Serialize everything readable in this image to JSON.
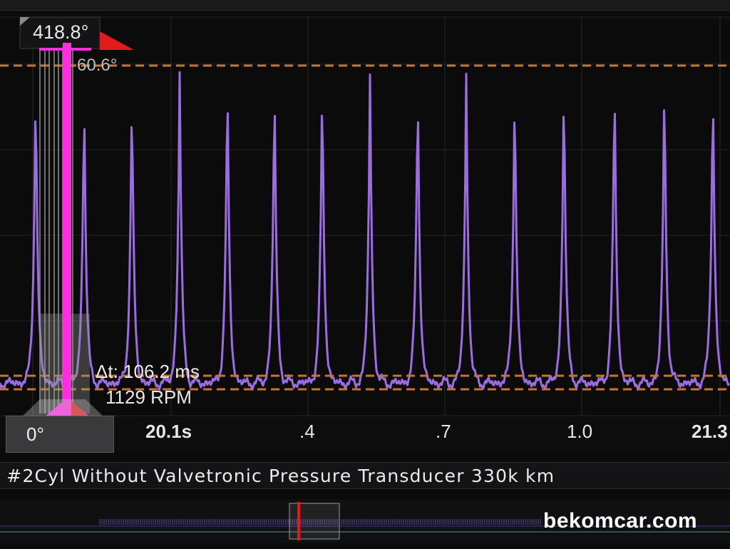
{
  "cursor": {
    "top_angle": "418.8°",
    "second_angle": "60.6°",
    "delta_time": "Δt: 106.2 ms",
    "rpm": "1129 RPM",
    "bottom_angle": "0°"
  },
  "axis": {
    "ticks": [
      "20.1s",
      ".4",
      ".7",
      "1.0",
      "21.3"
    ]
  },
  "caption": "i #2Cyl Without Valvetronic Pressure Transducer 330k km",
  "watermark": "bekomcar.com",
  "colors": {
    "trace": "#9a6ee0",
    "cursor": "#ff2fe0",
    "reference_line": "#c8742a",
    "marker_red": "#e31a1a"
  }
}
